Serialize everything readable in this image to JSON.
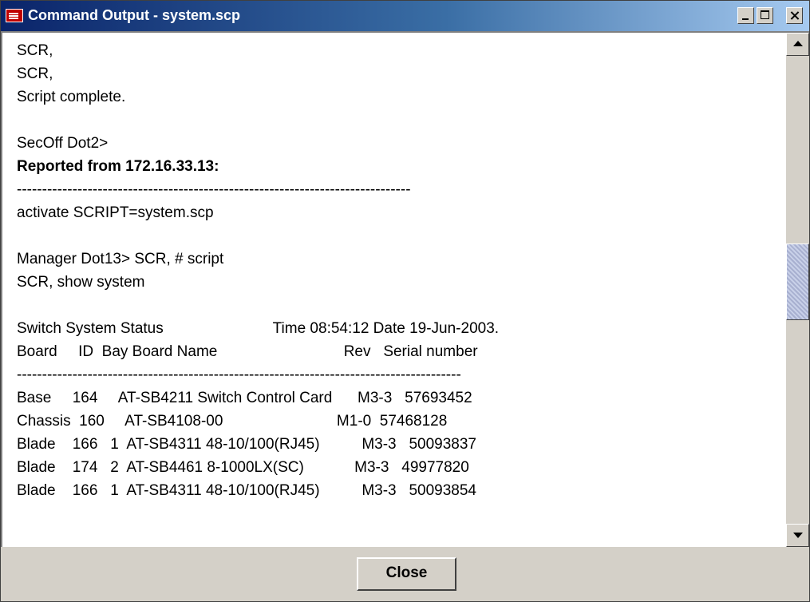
{
  "window": {
    "title": "Command Output - system.scp",
    "app_icon": "allied-telesyn-icon",
    "controls": [
      "minimize-icon",
      "maximize-icon",
      "close-icon"
    ]
  },
  "output": {
    "lines": [
      {
        "text": "SCR,",
        "bold": false
      },
      {
        "text": "SCR,",
        "bold": false
      },
      {
        "text": "Script complete.",
        "bold": false
      },
      {
        "text": "",
        "bold": false
      },
      {
        "text": "SecOff Dot2>",
        "bold": false
      },
      {
        "text": "Reported from 172.16.33.13:",
        "bold": true
      },
      {
        "text": "------------------------------------------------------------------------------",
        "bold": false
      },
      {
        "text": "activate SCRIPT=system.scp",
        "bold": false
      },
      {
        "text": "",
        "bold": false
      },
      {
        "text": "Manager Dot13> SCR, # script",
        "bold": false
      },
      {
        "text": "SCR, show system",
        "bold": false
      },
      {
        "text": "",
        "bold": false
      },
      {
        "text": "Switch System Status                          Time 08:54:12 Date 19-Jun-2003.",
        "bold": false
      },
      {
        "text": "Board     ID  Bay Board Name                              Rev   Serial number",
        "bold": false
      },
      {
        "text": "----------------------------------------------------------------------------------------",
        "bold": false
      },
      {
        "text": "Base     164     AT-SB4211 Switch Control Card      M3-3   57693452",
        "bold": false
      },
      {
        "text": "Chassis  160     AT-SB4108-00                           M1-0  57468128",
        "bold": false
      },
      {
        "text": "Blade    166   1  AT-SB4311 48-10/100(RJ45)          M3-3   50093837",
        "bold": false
      },
      {
        "text": "Blade    174   2  AT-SB4461 8-1000LX(SC)            M3-3   49977820",
        "bold": false
      },
      {
        "text": "Blade    166   1  AT-SB4311 48-10/100(RJ45)          M3-3   50093854",
        "bold": false
      }
    ]
  },
  "scrollbar": {
    "up_icon": "scroll-up-arrow-icon",
    "down_icon": "scroll-down-arrow-icon",
    "position_fraction": 0.48
  },
  "footer": {
    "close_label": "Close"
  }
}
